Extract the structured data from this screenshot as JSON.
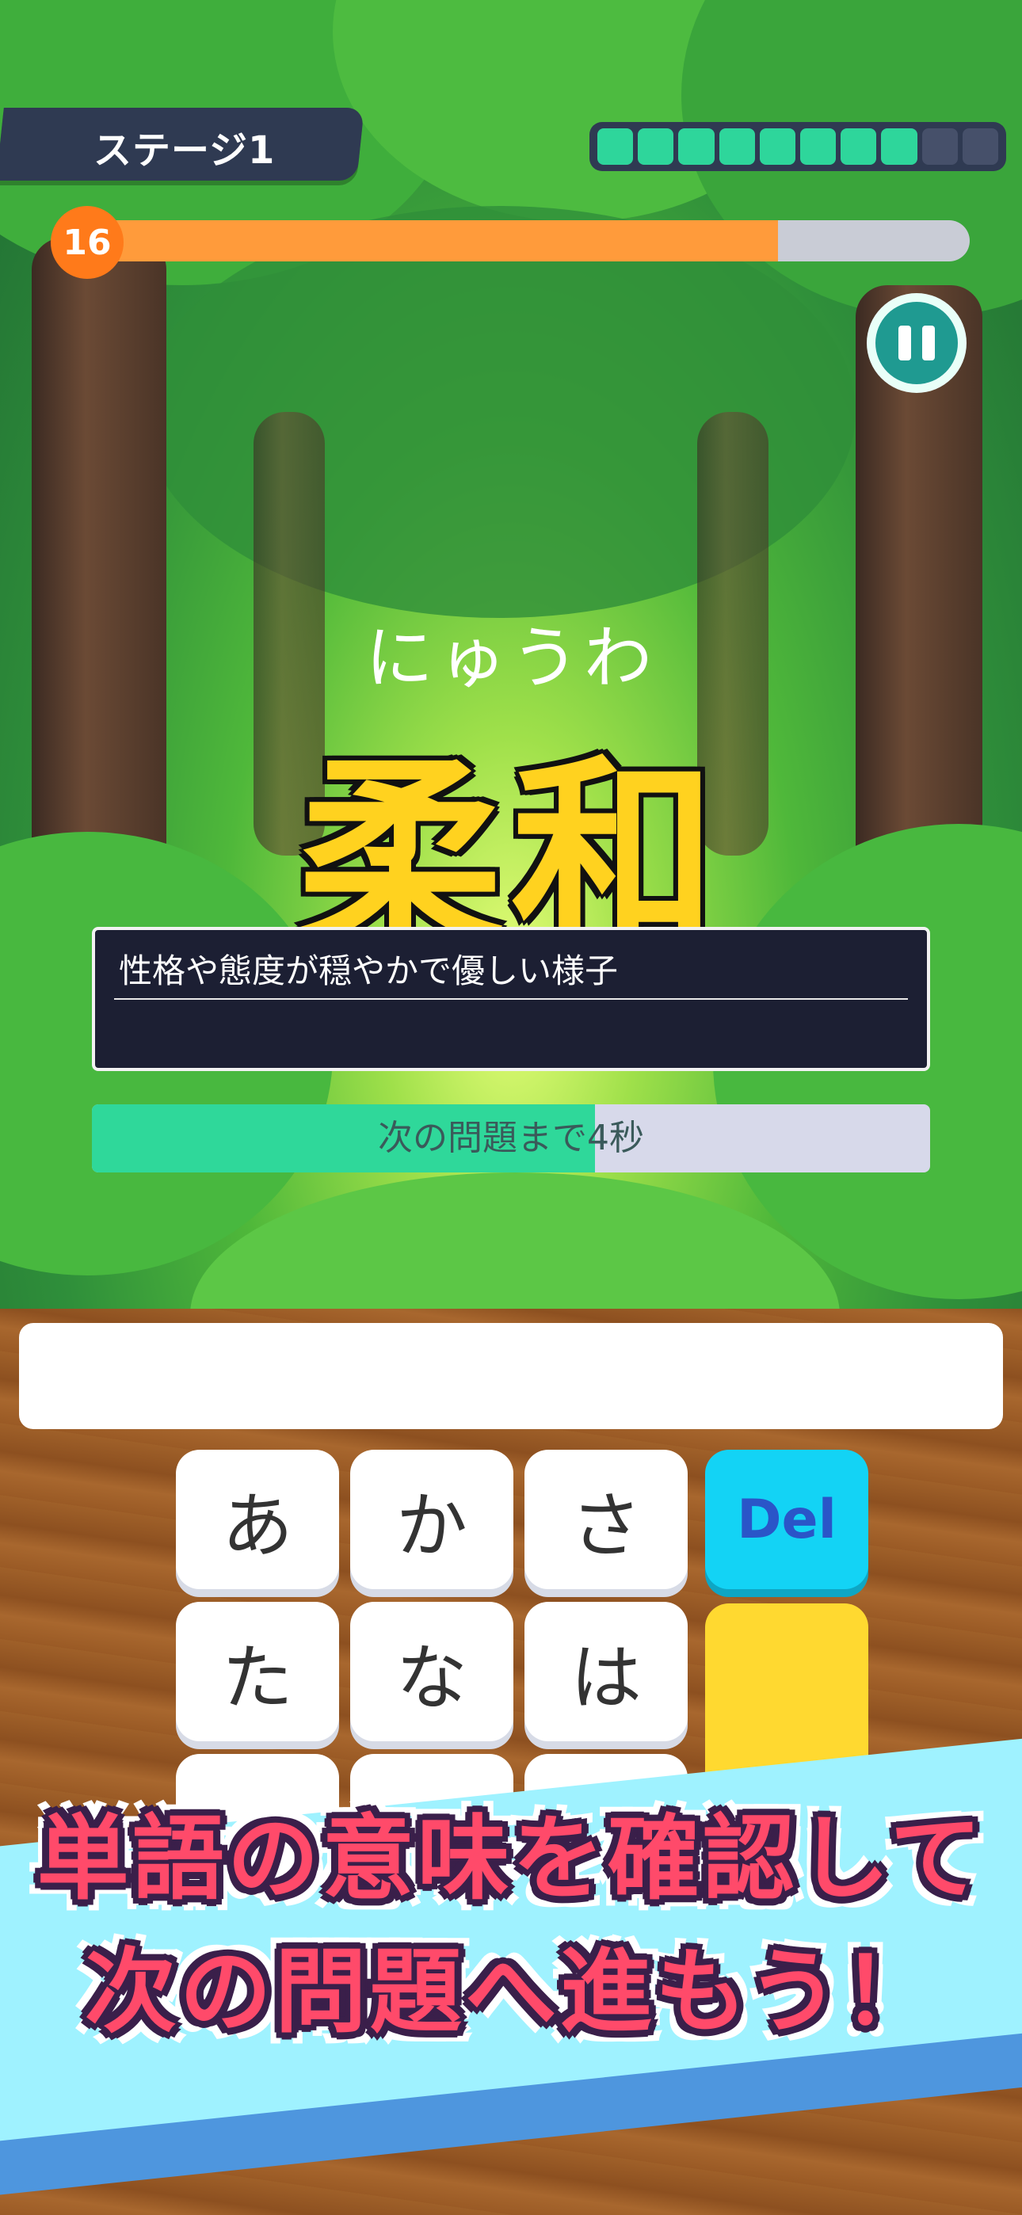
{
  "header": {
    "stage_label": "ステージ1",
    "progress_segments_total": 10,
    "progress_segments_done": 8,
    "timer_seconds": "16",
    "timer_fraction": 0.79
  },
  "question": {
    "reading": "にゅうわ",
    "kanji": "柔和",
    "meaning": "性格や態度が穏やかで優しい様子"
  },
  "next": {
    "text": "次の問題まで4秒",
    "fraction": 0.6
  },
  "answer": {
    "value": ""
  },
  "keyboard": {
    "keys": [
      "あ",
      "か",
      "さ",
      "た",
      "な",
      "は"
    ],
    "delete_label": "Del"
  },
  "banner": {
    "line1": "単語の意味を確認して",
    "line2": "次の問題へ進もう！"
  },
  "colors": {
    "accent_green": "#2ed69b",
    "timer_orange": "#ff9b3b",
    "kanji_yellow": "#ffd21f",
    "banner_pink": "#ff4a6a"
  },
  "icons": {
    "pause": "pause-icon"
  }
}
